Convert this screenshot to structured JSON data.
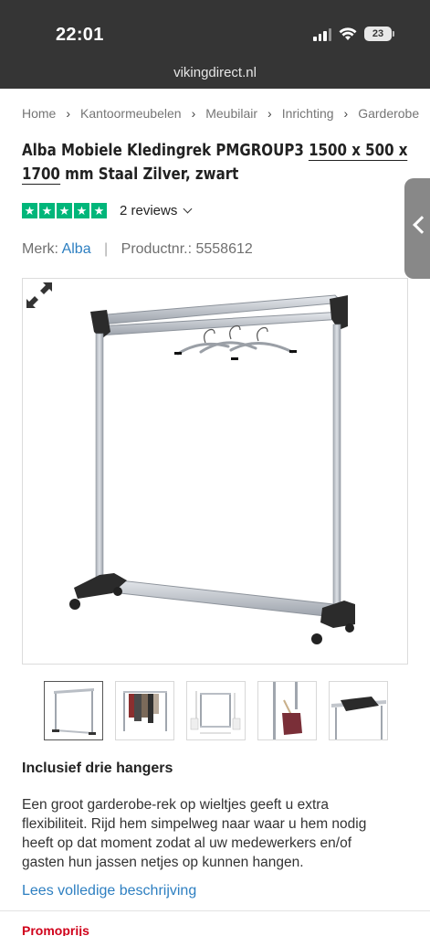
{
  "status_bar": {
    "time": "22:01",
    "battery": "23"
  },
  "browser": {
    "url": "vikingdirect.nl"
  },
  "breadcrumb": [
    "Home",
    "Kantoormeubelen",
    "Meubilair",
    "Inrichting",
    "Garderobe"
  ],
  "product": {
    "title_part1": "Alba Mobiele Kledingrek PMGROUP3 ",
    "title_underlined1": "1500 x 500 x",
    "title_underlined2": "1700",
    "title_part2": " mm Staal Zilver, zwart",
    "reviews_label": "2 reviews",
    "rating_stars": 5,
    "brand_label": "Merk:",
    "brand_value": "Alba",
    "product_number_label": "Productnr.:",
    "product_number": "5558612"
  },
  "gallery": {
    "thumbnails": [
      "rack-front",
      "rack-with-clothes",
      "rack-dimensions",
      "rack-with-bag",
      "rack-shelf-detail"
    ],
    "active_index": 0
  },
  "description": {
    "heading": "Inclusief drie hangers",
    "text": "Een groot garderobe-rek op wieltjes geeft u extra flexibiliteit. Rijd hem simpelweg naar waar u hem nodig heeft op dat moment zodat al uw medewerkers en/of gasten hun jassen netjes op kunnen hangen.",
    "read_more": "Lees volledige beschrijving"
  },
  "price_section": {
    "promo_label": "Promoprijs"
  },
  "colors": {
    "trustpilot": "#00b67a",
    "link": "#2d7fc1",
    "promo": "#d0021b"
  }
}
